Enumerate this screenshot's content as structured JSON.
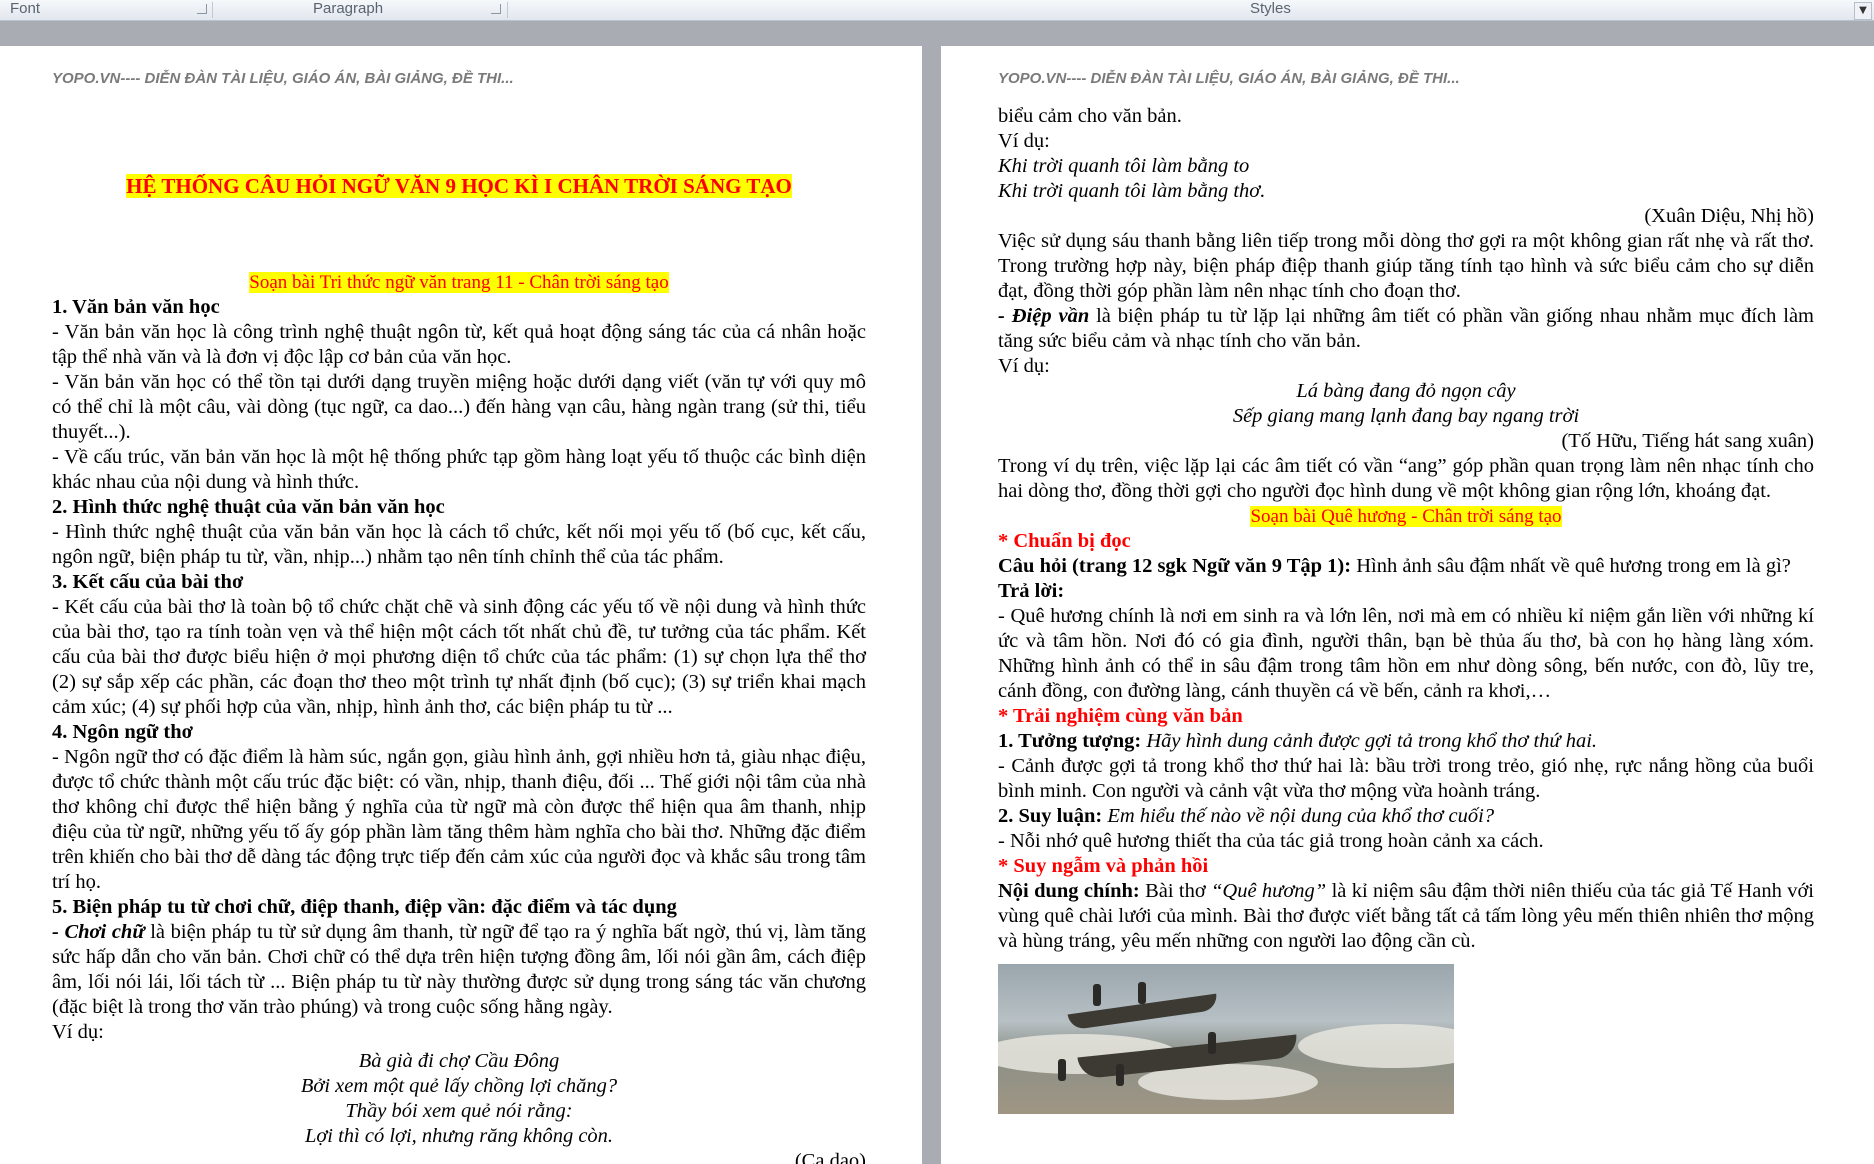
{
  "ribbon": {
    "groups": [
      "Font",
      "Paragraph",
      "Styles"
    ],
    "scroll_glyph": "▼"
  },
  "header_text": "YOPO.VN---- DIỄN ĐÀN TÀI LIỆU, GIÁO ÁN, BÀI GIẢNG, ĐỀ THI...",
  "page1": {
    "title": "HỆ THỐNG CÂU HỎI NGỮ VĂN 9 HỌC KÌ I CHÂN TRỜI SÁNG TẠO",
    "subtitle": "Soạn bài Tri thức ngữ văn trang 11 - Chân trời sáng tạo",
    "h1": "1. Văn bản văn học",
    "p1": "- Văn bản văn học là công trình nghệ thuật ngôn từ, kết quả hoạt động sáng tác của cá nhân hoặc tập thể nhà văn và là đơn vị độc lập cơ bản của văn học.",
    "p2": "- Văn bản văn học có thể tồn tại dưới dạng truyền miệng hoặc dưới dạng viết (văn tự với quy mô có thể chỉ là một câu, vài dòng (tục ngữ, ca dao...) đến hàng vạn câu, hàng ngàn trang (sử thi, tiểu thuyết...).",
    "p3": "- Về cấu trúc, văn bản văn học là một hệ thống phức tạp gồm hàng loạt yếu tố thuộc các bình diện khác nhau của nội dung và hình thức.",
    "h2": "2. Hình thức nghệ thuật của văn bản văn học",
    "p4": "- Hình thức nghệ thuật của văn bản văn học là cách tổ chức, kết nối mọi yếu tố (bố cục, kết cấu, ngôn ngữ, biện pháp tu từ, vần, nhịp...) nhằm tạo nên tính chỉnh thể của tác phẩm.",
    "h3": "3. Kết cấu của bài thơ",
    "p5": "- Kết cấu của bài thơ là toàn bộ tổ chức chặt chẽ và sinh động các yếu tố về nội dung và hình thức của bài thơ, tạo ra tính toàn vẹn và thể hiện một cách tốt nhất chủ đề, tư tưởng của tác phẩm. Kết cấu của bài thơ được biểu hiện ở mọi phương diện tổ chức của tác phẩm: (1) sự chọn lựa thể thơ (2) sự sắp xếp các phần, các đoạn thơ theo một trình tự nhất định (bố cục); (3) sự triển khai mạch cảm xúc; (4) sự phối hợp của vần, nhịp, hình ảnh thơ, các biện pháp tu từ ...",
    "h4": "4. Ngôn ngữ thơ",
    "p6": "- Ngôn ngữ thơ có đặc điểm là hàm súc, ngắn gọn, giàu hình ảnh, gợi nhiều hơn tả, giàu nhạc điệu, được tổ chức thành một cấu trúc đặc biệt: có vần, nhịp, thanh điệu, đối ... Thế giới nội tâm của nhà thơ không chỉ được thể hiện bằng ý nghĩa của từ ngữ mà còn được thể hiện qua âm thanh, nhịp điệu của từ ngữ, những yếu tố ấy góp phần làm tăng thêm hàm nghĩa cho bài thơ. Những đặc điểm trên khiến cho bài thơ dễ dàng tác động trực tiếp đến cảm xúc của người đọc và khắc sâu trong tâm trí họ.",
    "h5": "5. Biện pháp tu từ chơi chữ, điệp thanh, điệp vần: đặc điểm và tác dụng",
    "p7_lead": "- Chơi chữ",
    "p7_rest": " là biện pháp tu từ sử dụng âm thanh, từ ngữ để tạo ra ý nghĩa bất ngờ, thú vị, làm tăng sức hấp dẫn cho văn bản. Chơi chữ có thể dựa trên hiện tượng đồng âm, lối nói gần âm, cách điệp âm, lối nói lái, lối tách từ ... Biện pháp tu từ này thường được sử dụng trong sáng tác văn chương (đặc biệt là trong thơ văn trào phúng) và trong cuộc sống hằng ngày.",
    "vidu": "Ví dụ:",
    "poem": [
      "Bà già đi chợ Cầu Đông",
      "Bởi xem một quẻ lấy chồng lợi chăng?",
      "Thầy bói xem quẻ nói rằng:",
      "Lợi thì có lợi, nhưng răng không còn."
    ],
    "source": "(Ca dao)"
  },
  "page2": {
    "l1": "biểu cảm cho văn bản.",
    "vidu1": "Ví dụ:",
    "poem1": [
      "Khi trời quanh tôi làm bằng to",
      "Khi trời quanh tôi làm bằng thơ."
    ],
    "source1": "(Xuân Diệu, Nhị hồ)",
    "p1": "Việc sử dụng sáu thanh bằng liên tiếp trong mỗi dòng thơ gợi ra một không gian rất nhẹ và rất thơ. Trong trường hợp này, biện pháp điệp thanh giúp tăng tính tạo hình và sức biểu cảm cho sự diễn đạt, đồng thời góp phần làm nên nhạc tính cho đoạn thơ.",
    "p2_lead": "- Điệp vần",
    "p2_rest": " là biện pháp tu từ lặp lại những âm tiết có phần vần giống nhau nhằm mục đích làm tăng sức biểu cảm và nhạc tính cho văn bản.",
    "vidu2": "Ví dụ:",
    "poem2": [
      "Lá bàng đang đỏ ngọn cây",
      "Sếp giang mang lạnh đang bay ngang trời"
    ],
    "source2": "(Tố Hữu, Tiếng hát sang xuân)",
    "p3": "Trong ví dụ trên, việc lặp lại các âm tiết có vần “ang” góp phần quan trọng làm nên nhạc tính cho hai dòng thơ, đồng thời gợi cho người đọc hình dung về một không gian rộng lớn, khoáng đạt.",
    "subtitle": "Soạn bài Quê hương - Chân trời sáng tạo",
    "s1": "* Chuẩn bị đọc",
    "q1_lead": "Câu hỏi (trang 12 sgk Ngữ văn 9 Tập 1):",
    "q1_rest": " Hình ảnh sâu đậm nhất về quê hương trong em là gì?",
    "ans": "Trả lời:",
    "p4": "- Quê hương chính là nơi em sinh ra và lớn lên, nơi mà em có nhiều kỉ niệm gắn liền với những kí ức và tâm hồn. Nơi đó có gia đình, người thân, bạn bè thủa ấu thơ, bà con họ hàng làng xóm. Những hình ảnh có thể in sâu đậm trong tâm hồn em như dòng sông, bến nước, con đò, lũy tre, cánh đồng, con đường làng, cánh thuyền cá về bến, cảnh ra khơi,…",
    "s2": "* Trải nghiệm cùng văn bản",
    "t1_lead": "1. Tưởng tượng:",
    "t1_rest": " Hãy hình dung cảnh được gợi tả trong khổ thơ thứ hai.",
    "p5": "- Cảnh được gợi tả trong khổ thơ thứ hai là: bầu trời trong trẻo, gió nhẹ, rực nắng hồng của buổi bình minh. Con người và cảnh vật vừa thơ mộng vừa hoành tráng.",
    "t2_lead": "2. Suy luận:",
    "t2_rest": " Em hiểu thế nào về nội dung của khổ thơ cuối?",
    "p6": "- Nỗi nhớ quê hương thiết tha của tác giả trong hoàn cảnh xa cách.",
    "s3": "* Suy ngẫm và phản hồi",
    "nd_lead": "Nội dung chính:",
    "nd_mid": " Bài thơ ",
    "nd_it": "“Quê hương”",
    "nd_rest": " là kỉ niệm sâu đậm thời niên thiếu của tác giả Tế Hanh với vùng quê chài lưới của mình. Bài thơ được viết bằng tất cả tấm lòng yêu mến thiên nhiên thơ mộng và hùng tráng, yêu mến những con người lao động cần cù."
  }
}
